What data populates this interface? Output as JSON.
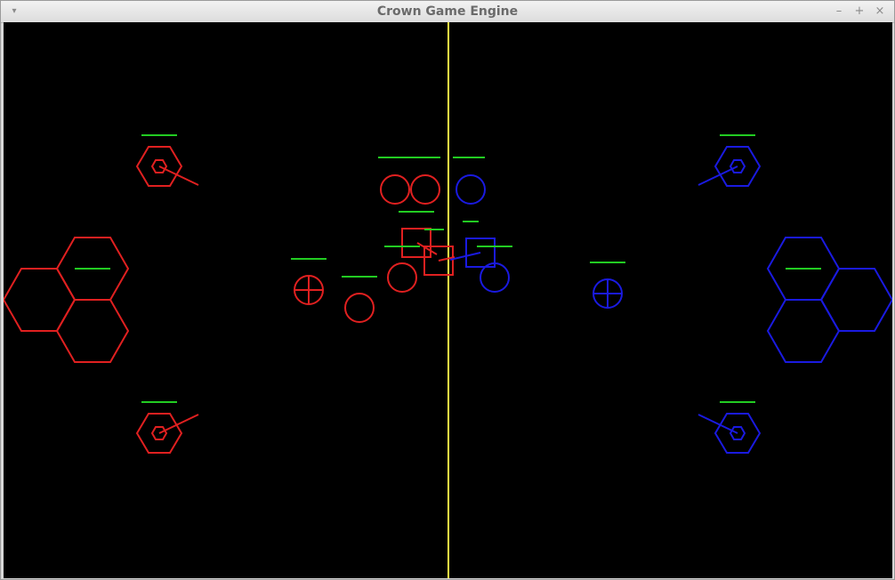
{
  "window": {
    "title": "Crown Game Engine",
    "menu_glyph": "▾",
    "minimize_glyph": "–",
    "maximize_glyph": "+",
    "close_glyph": "×"
  },
  "scene": {
    "colors": {
      "team_red": "#e02020",
      "team_blue": "#1a1ae0",
      "health_bar": "#22cc22",
      "center_line": "#ffee44",
      "background": "#000000"
    }
  }
}
